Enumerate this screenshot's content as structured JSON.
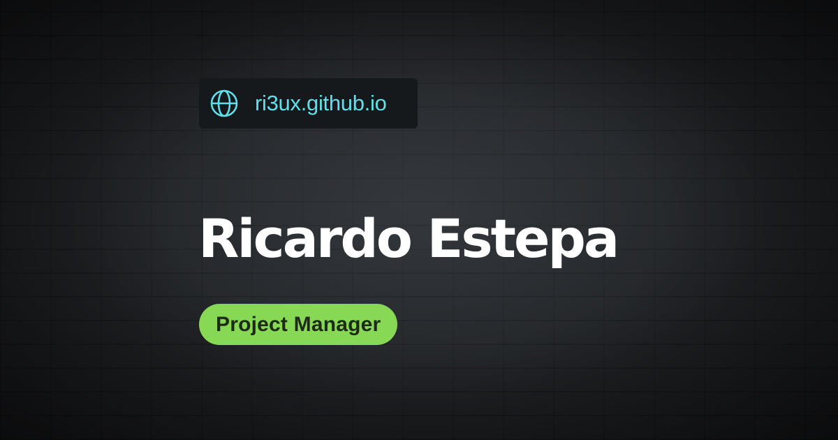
{
  "site": {
    "url": "ri3ux.github.io",
    "icon": "globe-icon",
    "url_color": "#5fe0ea"
  },
  "profile": {
    "name": "Ricardo Estepa",
    "role": "Project Manager",
    "role_badge_color": "#86d855"
  },
  "background": {
    "style": "dark brick wall texture",
    "base_color": "#1f2225"
  }
}
